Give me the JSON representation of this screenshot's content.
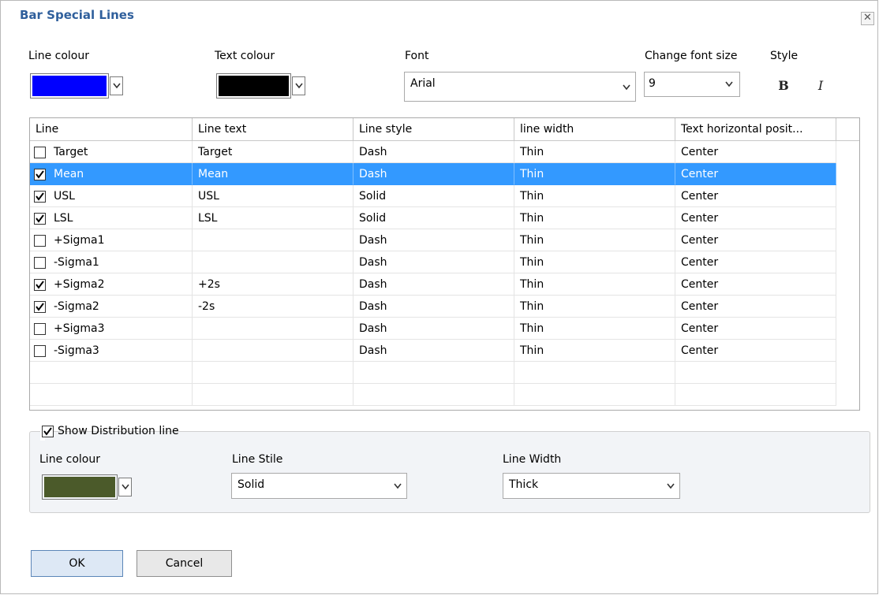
{
  "window": {
    "title": "Bar Special Lines",
    "close_glyph": "✕"
  },
  "top": {
    "line_colour_label": "Line colour",
    "line_colour": "#0000ff",
    "text_colour_label": "Text colour",
    "text_colour": "#000000",
    "font_label": "Font",
    "font_value": "Arial",
    "font_size_label": "Change font size",
    "font_size_value": "9",
    "style_label": "Style",
    "bold_glyph": "B",
    "italic_glyph": "I"
  },
  "table": {
    "columns": [
      "Line",
      "Line text",
      "Line style",
      "line width",
      "Text horizontal posit..."
    ],
    "rows": [
      {
        "checked": false,
        "line": "Target",
        "text": "Target",
        "style": "Dash",
        "width": "Thin",
        "pos": "Center"
      },
      {
        "checked": true,
        "line": "Mean",
        "text": "Mean",
        "style": "Dash",
        "width": "Thin",
        "pos": "Center",
        "selected": true
      },
      {
        "checked": true,
        "line": "USL",
        "text": "USL",
        "style": "Solid",
        "width": "Thin",
        "pos": "Center"
      },
      {
        "checked": true,
        "line": "LSL",
        "text": "LSL",
        "style": "Solid",
        "width": "Thin",
        "pos": "Center"
      },
      {
        "checked": false,
        "line": "+Sigma1",
        "text": "",
        "style": "Dash",
        "width": "Thin",
        "pos": "Center"
      },
      {
        "checked": false,
        "line": "-Sigma1",
        "text": "",
        "style": "Dash",
        "width": "Thin",
        "pos": "Center"
      },
      {
        "checked": true,
        "line": "+Sigma2",
        "text": "+2s",
        "style": "Dash",
        "width": "Thin",
        "pos": "Center"
      },
      {
        "checked": true,
        "line": "-Sigma2",
        "text": "-2s",
        "style": "Dash",
        "width": "Thin",
        "pos": "Center"
      },
      {
        "checked": false,
        "line": "+Sigma3",
        "text": "",
        "style": "Dash",
        "width": "Thin",
        "pos": "Center"
      },
      {
        "checked": false,
        "line": "-Sigma3",
        "text": "",
        "style": "Dash",
        "width": "Thin",
        "pos": "Center"
      }
    ]
  },
  "distribution": {
    "show_label": "Show Distribution line",
    "show_checked": true,
    "line_colour_label": "Line colour",
    "line_colour": "#4b5a2a",
    "line_stile_label": "Line Stile",
    "line_stile_value": "Solid",
    "line_width_label": "Line Width",
    "line_width_value": "Thick"
  },
  "buttons": {
    "ok": "OK",
    "cancel": "Cancel"
  },
  "colors": {
    "selection": "#3399ff",
    "title": "#2f5f9c"
  }
}
